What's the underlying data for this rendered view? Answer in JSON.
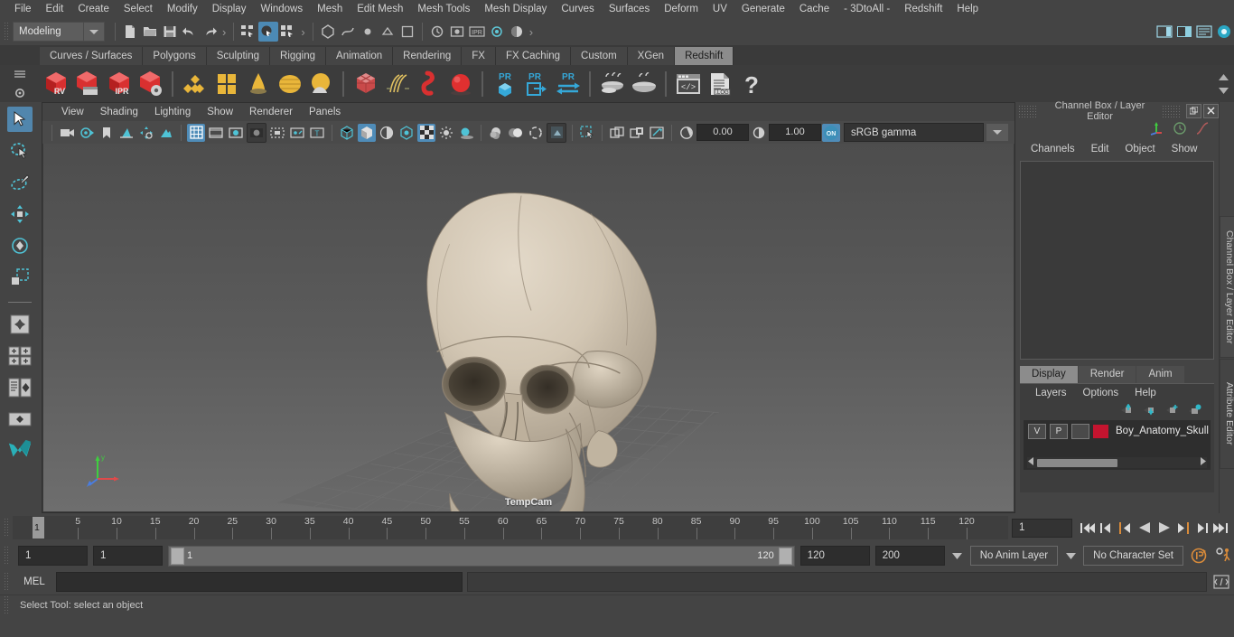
{
  "menubar": {
    "items": [
      "File",
      "Edit",
      "Create",
      "Select",
      "Modify",
      "Display",
      "Windows",
      "Mesh",
      "Edit Mesh",
      "Mesh Tools",
      "Mesh Display",
      "Curves",
      "Surfaces",
      "Deform",
      "UV",
      "Generate",
      "Cache",
      "- 3DtoAll -",
      "Redshift",
      "Help"
    ]
  },
  "statusline": {
    "menuset": "Modeling",
    "icons": [
      "new-scene-icon",
      "open-scene-icon",
      "save-scene-icon",
      "undo-icon",
      "redo-icon",
      "select-hierarchy-icon",
      "select-object-icon",
      "select-component-icon"
    ],
    "right_icons": [
      "sidebar-toggle-icon",
      "channel-box-toggle-icon",
      "attribute-editor-toggle-icon",
      "tool-settings-toggle-icon"
    ]
  },
  "shelf": {
    "tabs": [
      "Curves / Surfaces",
      "Polygons",
      "Sculpting",
      "Rigging",
      "Animation",
      "Rendering",
      "FX",
      "FX Caching",
      "Custom",
      "XGen",
      "Redshift"
    ],
    "active_tab": "Redshift",
    "buttons": [
      {
        "name": "redshift-render-view",
        "label": "RV"
      },
      {
        "name": "redshift-render-sequence",
        "label": ""
      },
      {
        "name": "redshift-ipr",
        "label": "IPR"
      },
      {
        "name": "redshift-render-settings",
        "label": ""
      },
      {
        "name": "redshift-area-light",
        "label": ""
      },
      {
        "name": "redshift-physical-light",
        "label": ""
      },
      {
        "name": "redshift-ies-light",
        "label": ""
      },
      {
        "name": "redshift-dome-light",
        "label": ""
      },
      {
        "name": "redshift-portal-light",
        "label": ""
      },
      {
        "name": "redshift-proxy",
        "label": ""
      },
      {
        "name": "redshift-hair",
        "label": ""
      },
      {
        "name": "redshift-volume",
        "label": ""
      },
      {
        "name": "redshift-sphere-object",
        "label": ""
      },
      {
        "name": "redshift-pr-object",
        "label": "PR"
      },
      {
        "name": "redshift-pr-import",
        "label": "PR"
      },
      {
        "name": "redshift-pr-export",
        "label": "PR"
      },
      {
        "name": "redshift-bake-set",
        "label": ""
      },
      {
        "name": "redshift-bake-all",
        "label": ""
      },
      {
        "name": "redshift-script-editor",
        "label": ""
      },
      {
        "name": "redshift-log",
        "label": ".LOG"
      },
      {
        "name": "redshift-help",
        "label": "?"
      }
    ]
  },
  "toolbox": {
    "tools": [
      "select-tool",
      "lasso-select-tool",
      "paint-select-tool",
      "move-tool",
      "rotate-tool",
      "scale-tool",
      "last-tool-used",
      "snap-grid-toggles",
      "outliner-persp-layout",
      "persp-graph-layout",
      "persp-layout",
      "maya-logo"
    ]
  },
  "viewport": {
    "menus": [
      "View",
      "Shading",
      "Lighting",
      "Show",
      "Renderer",
      "Panels"
    ],
    "exposure": "0.00",
    "gamma": "1.00",
    "color_profile": "sRGB gamma",
    "camera_label": "TempCam",
    "tool_icons": [
      "select-camera-icon",
      "bookmark-icon",
      "camera-attributes-icon",
      "image-plane-icon",
      "two-d-pan-zoom-icon",
      "grid-toggle-icon",
      "film-gate-icon",
      "resolution-gate-icon",
      "gate-mask-icon",
      "field-chart-icon",
      "safe-action-icon",
      "safe-title-icon",
      "wireframe-icon",
      "smooth-shade-icon",
      "shade-wire-icon",
      "textured-icon",
      "use-lights-icon",
      "shadows-icon",
      "ao-icon",
      "motion-blur-icon",
      "multisample-icon",
      "xray-icon",
      "xray-joints-icon",
      "isolate-select-icon",
      "hud-icon",
      "viewport-layout-icon",
      "grid-display-icon",
      "exposure-icon",
      "gamma-icon",
      "color-management-icon"
    ]
  },
  "channelbox": {
    "title": "Channel Box / Layer Editor",
    "menus": [
      "Channels",
      "Edit",
      "Object",
      "Show"
    ],
    "side_tabs": [
      "Channel Box / Layer Editor",
      "Attribute Editor"
    ]
  },
  "layereditor": {
    "tabs": [
      "Display",
      "Render",
      "Anim"
    ],
    "active_tab": "Display",
    "menus": [
      "Layers",
      "Options",
      "Help"
    ],
    "buttons": [
      "move-layer-up-icon",
      "move-layer-down-icon",
      "new-layer-icon",
      "new-layer-from-selected-icon"
    ],
    "layers": [
      {
        "visibility": "V",
        "playback": "P",
        "shading": "",
        "color": "#c4142f",
        "name": "Boy_Anatomy_Skull"
      }
    ]
  },
  "timeslider": {
    "ticks": [
      5,
      10,
      15,
      20,
      25,
      30,
      35,
      40,
      45,
      50,
      55,
      60,
      65,
      70,
      75,
      80,
      85,
      90,
      95,
      100,
      105,
      110,
      115,
      120
    ],
    "current_frame": "1",
    "frame_field": "1",
    "playback_buttons": [
      "go-to-start-icon",
      "step-back-key-icon",
      "step-back-frame-icon",
      "play-backwards-icon",
      "play-forwards-icon",
      "step-forward-frame-icon",
      "step-forward-key-icon",
      "go-to-end-icon"
    ]
  },
  "rangeslider": {
    "anim_start": "1",
    "range_start": "1",
    "bar_start": "1",
    "bar_end": "120",
    "range_end": "120",
    "anim_end": "200",
    "anim_layer": "No Anim Layer",
    "character_set": "No Character Set",
    "right_icons": [
      "auto-key-icon",
      "animation-preferences-icon"
    ]
  },
  "commandline": {
    "label": "MEL",
    "input_value": "",
    "output_value": "",
    "script-editor-icon": "script-editor-icon"
  },
  "helpline": {
    "text": "Select Tool: select an object"
  },
  "colors": {
    "accent_blue": "#4f8cb8",
    "layer_red": "#c4142f",
    "shelf_active": "#8c8c8c",
    "orange": "#d98b3a"
  }
}
